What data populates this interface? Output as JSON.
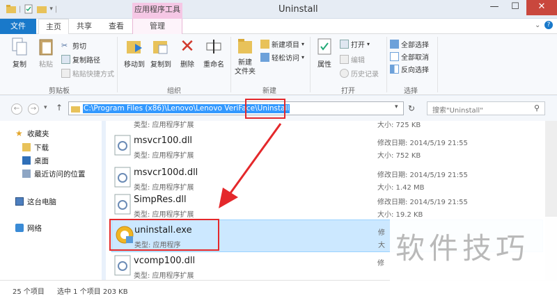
{
  "window": {
    "title": "Uninstall",
    "context_tab_group": "应用程序工具"
  },
  "window_controls": {
    "minimize": "—",
    "maximize": "☐",
    "close": "✕"
  },
  "ribbon_tabs": [
    "文件",
    "主页",
    "共享",
    "查看",
    "管理"
  ],
  "ribbon": {
    "clipboard": {
      "copy": "复制",
      "paste": "粘贴",
      "cut": "剪切",
      "copy_path": "复制路径",
      "paste_shortcut": "粘贴快捷方式",
      "label": "剪贴板"
    },
    "organize": {
      "move_to": "移动到",
      "copy_to": "复制到",
      "delete": "删除",
      "rename": "重命名",
      "label": "组织"
    },
    "new": {
      "new_folder": "新建\n文件夹",
      "new_item": "新建项目",
      "easy_access": "轻松访问",
      "label": "新建"
    },
    "open": {
      "properties": "属性",
      "open": "打开",
      "edit": "编辑",
      "history": "历史记录",
      "label": "打开"
    },
    "select": {
      "select_all": "全部选择",
      "select_none": "全部取消",
      "invert": "反向选择",
      "label": "选择"
    }
  },
  "address": {
    "path_prefix": "C:\\Program Files (x86)\\Lenovo\\Lenovo VeriFace\\",
    "path_last": "Uninstall",
    "search_placeholder": "搜索\"Uninstall\""
  },
  "nav_pane": {
    "favorites": "收藏夹",
    "downloads": "下载",
    "desktop": "桌面",
    "recent": "最近访问的位置",
    "this_pc": "这台电脑",
    "network": "网络"
  },
  "files": [
    {
      "name": "",
      "type": "类型: 应用程序扩展",
      "modified": "",
      "size": "大小: 725 KB"
    },
    {
      "name": "msvcr100.dll",
      "type": "类型: 应用程序扩展",
      "modified": "修改日期: 2014/5/19 21:55",
      "size": "大小: 752 KB"
    },
    {
      "name": "msvcr100d.dll",
      "type": "类型: 应用程序扩展",
      "modified": "修改日期: 2014/5/19 21:55",
      "size": "大小: 1.42 MB"
    },
    {
      "name": "SimpRes.dll",
      "type": "类型: 应用程序扩展",
      "modified": "修改日期: 2014/5/19 21:55",
      "size": "大小: 19.2 KB"
    },
    {
      "name": "uninstall.exe",
      "type": "类型: 应用程序",
      "modified": "修",
      "size": "大"
    },
    {
      "name": "vcomp100.dll",
      "type": "类型: 应用程序扩展",
      "modified": "修",
      "size": ""
    }
  ],
  "status": {
    "count": "25 个项目",
    "selected": "选中 1 个项目 203 KB"
  },
  "watermark": "软件技巧",
  "colors": {
    "accent": "#1979ca",
    "highlight": "#e4282b",
    "selection": "#cce8ff"
  }
}
